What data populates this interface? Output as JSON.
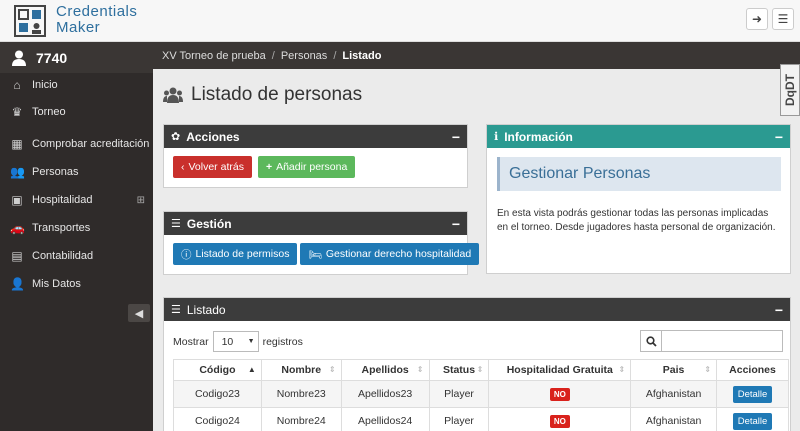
{
  "app": {
    "logo_line1": "Credentials",
    "logo_line2": "Maker",
    "badge": "DqDT"
  },
  "sidebar": {
    "user": "7740",
    "items": [
      {
        "label": "Inicio",
        "icon": "home-icon"
      },
      {
        "label": "Torneo",
        "icon": "trophy-icon"
      },
      {
        "label": "Comprobar acreditación",
        "icon": "qrcode-icon"
      },
      {
        "label": "Personas",
        "icon": "users-icon"
      },
      {
        "label": "Hospitalidad",
        "icon": "h-square-icon"
      },
      {
        "label": "Transportes",
        "icon": "car-icon"
      },
      {
        "label": "Contabilidad",
        "icon": "money-icon"
      },
      {
        "label": "Mis Datos",
        "icon": "user-icon"
      }
    ]
  },
  "breadcrumb": [
    "XV Torneo de prueba",
    "Personas",
    "Listado"
  ],
  "page": {
    "title": "Listado de personas"
  },
  "acciones": {
    "title": "Acciones",
    "back": "Volver atrás",
    "add": "Añadir persona"
  },
  "gestion": {
    "title": "Gestión",
    "permisos": "Listado de permisos",
    "hospitalidad": "Gestionar derecho hospitalidad"
  },
  "informacion": {
    "title": "Información",
    "heading": "Gestionar Personas",
    "text": "En esta vista podrás gestionar todas las personas implicadas en el torneo. Desde jugadores hasta personal de organización."
  },
  "listado": {
    "title": "Listado",
    "show_label": "Mostrar",
    "page_length": "10",
    "records_label": "registros",
    "columns": [
      "Código",
      "Nombre",
      "Apellidos",
      "Status",
      "Hospitalidad Gratuita",
      "Pais",
      "Acciones"
    ],
    "rows": [
      {
        "codigo": "Codigo23",
        "nombre": "Nombre23",
        "apellidos": "Apellidos23",
        "status": "Player",
        "hospitalidad": "NO",
        "pais": "Afghanistan",
        "accion": "Detalle"
      },
      {
        "codigo": "Codigo24",
        "nombre": "Nombre24",
        "apellidos": "Apellidos24",
        "status": "Player",
        "hospitalidad": "NO",
        "pais": "Afghanistan",
        "accion": "Detalle"
      }
    ]
  }
}
